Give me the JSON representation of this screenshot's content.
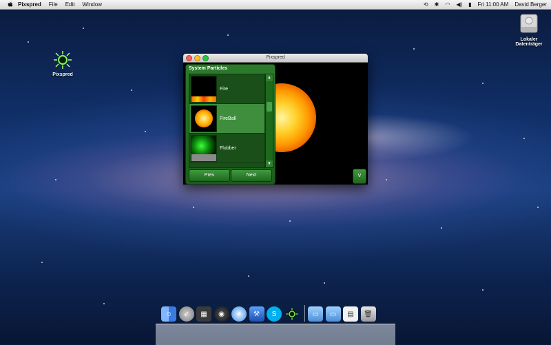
{
  "menubar": {
    "app_name": "Pixspred",
    "menus": [
      "File",
      "Edit",
      "Window"
    ],
    "time": "Fri 11:00 AM",
    "user": "David Berger"
  },
  "desktop": {
    "app_icon_label": "Pixspred",
    "drive_label_line1": "Lokaler",
    "drive_label_line2": "Datenträger"
  },
  "window": {
    "title": "Pixspred",
    "panel_title": "System Particles",
    "items": [
      {
        "label": "Fire",
        "selected": false
      },
      {
        "label": "FireBall",
        "selected": true
      },
      {
        "label": "Flubber",
        "selected": false
      }
    ],
    "prev_label": "Prev",
    "next_label": "Next",
    "v_label": "V"
  },
  "dock": {
    "items": [
      "finder-icon",
      "launchpad-icon",
      "mission-control-icon",
      "dashboard-icon",
      "safari-icon",
      "xcode-icon",
      "skype-icon",
      "pixspred-icon"
    ],
    "right_items": [
      "applications-folder-icon",
      "documents-folder-icon",
      "downloads-stack-icon",
      "trash-icon"
    ]
  }
}
